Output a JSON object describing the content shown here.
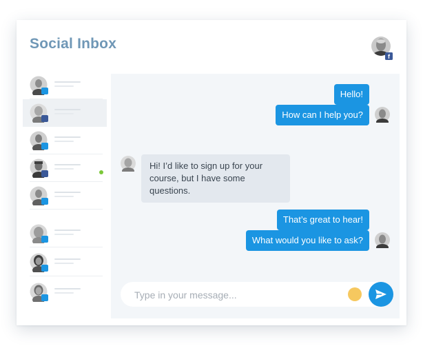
{
  "app": {
    "title": "Social Inbox",
    "accent_color": "#1b95e2",
    "title_color": "#6f97b6",
    "header_avatar": {
      "icon": "user-avatar-with-facebook-badge",
      "badge": "f"
    }
  },
  "sidebar": {
    "contacts": [
      {
        "icon": "user-avatar",
        "badge_color": "#1b95e2",
        "active": false
      },
      {
        "icon": "user-avatar",
        "badge_color": "#3b5998",
        "active": true
      },
      {
        "icon": "user-avatar",
        "badge_color": "#1b95e2",
        "active": false
      },
      {
        "icon": "user-avatar",
        "badge_color": "#3b5998",
        "active": false,
        "online": true
      },
      {
        "icon": "user-avatar",
        "badge_color": "#1b95e2",
        "active": false
      },
      {
        "icon": "user-avatar",
        "badge_color": "#1b95e2",
        "active": false
      },
      {
        "icon": "user-avatar",
        "badge_color": "#1b95e2",
        "active": false
      },
      {
        "icon": "user-avatar",
        "badge_color": "#1b95e2",
        "active": false
      }
    ],
    "online_color": "#7cc83a"
  },
  "chat": {
    "messages": [
      {
        "direction": "out",
        "text": "Hello!"
      },
      {
        "direction": "out",
        "text": "How can I help you?"
      },
      {
        "direction": "in",
        "text": "Hi! I’d like to sign up for your course, but I have some questions."
      },
      {
        "direction": "out",
        "text": "That’s great to hear!"
      },
      {
        "direction": "out",
        "text": "What would you like to ask?"
      }
    ],
    "input": {
      "placeholder": "Type in your message...",
      "value": ""
    },
    "emoji_icon": "emoji-icon",
    "send_icon": "send-icon"
  }
}
